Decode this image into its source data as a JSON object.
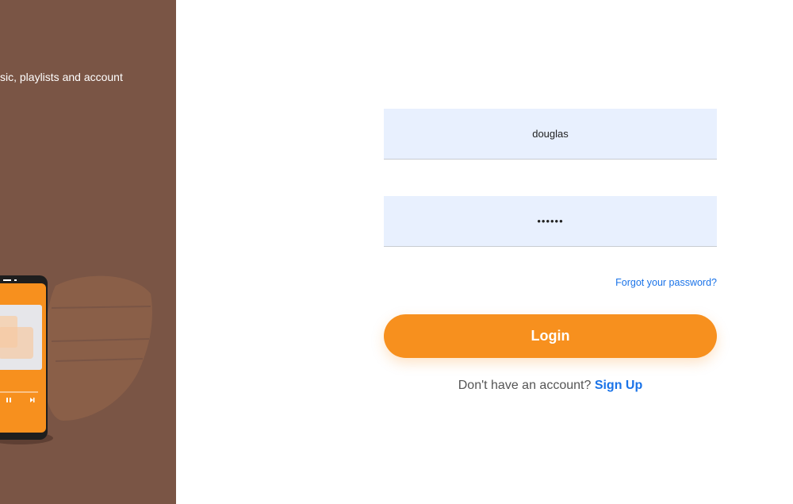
{
  "left_panel": {
    "tagline": "sic, playlists and account",
    "background": "#7a5545"
  },
  "form": {
    "username_value": "douglas",
    "password_value": "••••••",
    "forgot_label": "Forgot your password?",
    "login_label": "Login",
    "signup_prompt": "Don't have an account?",
    "signup_label": "Sign Up"
  },
  "colors": {
    "accent": "#f7901e",
    "link": "#1a73e8",
    "field_bg": "#e8f0fe"
  }
}
